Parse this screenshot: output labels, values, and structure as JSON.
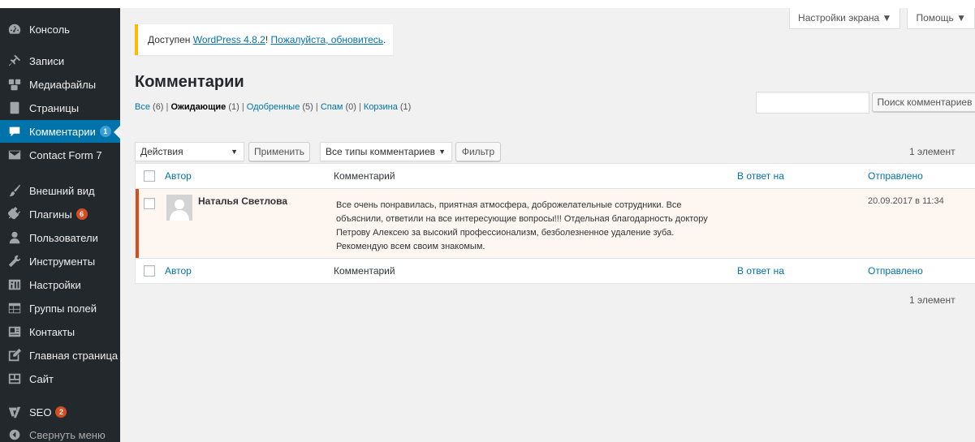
{
  "sidebar": {
    "items": [
      {
        "label": "Консоль",
        "icon": "dashboard-icon"
      },
      {
        "label": "Записи",
        "icon": "pin-icon"
      },
      {
        "label": "Медиафайлы",
        "icon": "media-icon"
      },
      {
        "label": "Страницы",
        "icon": "page-icon"
      },
      {
        "label": "Комментарии",
        "icon": "comment-icon",
        "badge": "1",
        "active": true
      },
      {
        "label": "Contact Form 7",
        "icon": "mail-icon"
      },
      {
        "label": "Внешний вид",
        "icon": "brush-icon"
      },
      {
        "label": "Плагины",
        "icon": "plugin-icon",
        "badge": "6"
      },
      {
        "label": "Пользователи",
        "icon": "user-icon"
      },
      {
        "label": "Инструменты",
        "icon": "wrench-icon"
      },
      {
        "label": "Настройки",
        "icon": "settings-icon"
      },
      {
        "label": "Группы полей",
        "icon": "table-icon"
      },
      {
        "label": "Контакты",
        "icon": "contacts-icon"
      },
      {
        "label": "Главная страница",
        "icon": "edit-icon"
      },
      {
        "label": "Сайт",
        "icon": "site-icon"
      },
      {
        "label": "SEO",
        "icon": "seo-icon",
        "badge": "2"
      }
    ],
    "collapse_label": "Свернуть меню"
  },
  "screen_meta": {
    "screen_options": "Настройки экрана ▼",
    "help": "Помощь ▼"
  },
  "notice": {
    "prefix": "Доступен ",
    "version_link": "WordPress 4.8.2",
    "middle": "! ",
    "update_link": "Пожалуйста, обновитесь",
    "suffix": "."
  },
  "page_title": "Комментарии",
  "filters": {
    "all": "Все",
    "all_count": "(6)",
    "pending": "Ожидающие",
    "pending_count": "(1)",
    "approved": "Одобренные",
    "approved_count": "(5)",
    "spam": "Спам",
    "spam_count": "(0)",
    "trash": "Корзина",
    "trash_count": "(1)",
    "sep": " | "
  },
  "search": {
    "placeholder": "",
    "button": "Поиск комментариев"
  },
  "toolbar": {
    "bulk_action": "Действия",
    "apply": "Применить",
    "type_filter": "Все типы комментариев",
    "filter": "Фильтр",
    "items_count": "1 элемент"
  },
  "table": {
    "columns": {
      "author": "Автор",
      "comment": "Комментарий",
      "in_reply_to": "В ответ на",
      "submitted": "Отправлено"
    },
    "rows": [
      {
        "author": "Наталья Светлова",
        "comment": "Все очень понравилась, приятная атмосфера, доброжелательные сотрудники. Все объяснили, ответили на все интересующие вопросы!!! Отдельная благодарность доктору Петрову Алексею за высокий профессионализм, безболезненное удаление зуба. Рекомендую всем своим знакомым.",
        "date": "20.09.2017 в 11:34"
      }
    ]
  },
  "colors": {
    "sidebar_bg": "#23282d",
    "active": "#0073aa",
    "badge": "#d54e21",
    "notice_border": "#ffb900",
    "pending_row": "#fef7f1"
  }
}
